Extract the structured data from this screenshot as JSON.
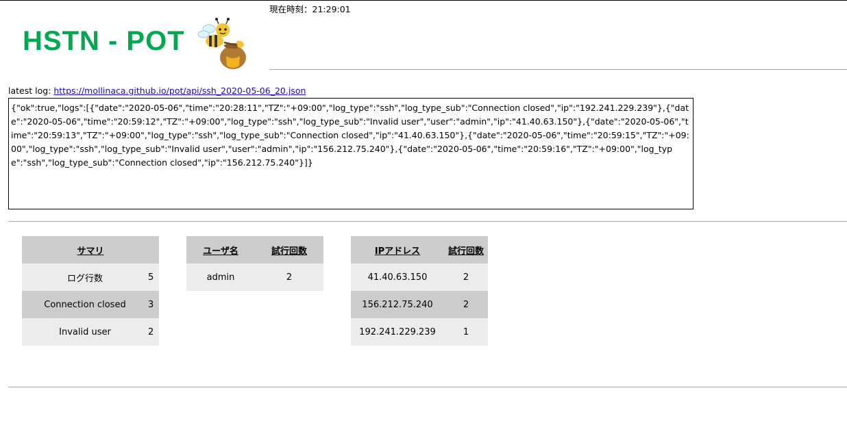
{
  "header": {
    "clock_label": "現在時刻：21:29:01",
    "logo_text": "HSTN - POT",
    "mascot_icon": "bee-honeypot-icon"
  },
  "latest_log": {
    "label": "latest log: ",
    "url": "https://mollinaca.github.io/pot/api/ssh_2020-05-06_20.json"
  },
  "json_text": "{\"ok\":true,\"logs\":[{\"date\":\"2020-05-06\",\"time\":\"20:28:11\",\"TZ\":\"+09:00\",\"log_type\":\"ssh\",\"log_type_sub\":\"Connection closed\",\"ip\":\"192.241.229.239\"},{\"date\":\"2020-05-06\",\"time\":\"20:59:12\",\"TZ\":\"+09:00\",\"log_type\":\"ssh\",\"log_type_sub\":\"Invalid user\",\"user\":\"admin\",\"ip\":\"41.40.63.150\"},{\"date\":\"2020-05-06\",\"time\":\"20:59:13\",\"TZ\":\"+09:00\",\"log_type\":\"ssh\",\"log_type_sub\":\"Connection closed\",\"ip\":\"41.40.63.150\"},{\"date\":\"2020-05-06\",\"time\":\"20:59:15\",\"TZ\":\"+09:00\",\"log_type\":\"ssh\",\"log_type_sub\":\"Invalid user\",\"user\":\"admin\",\"ip\":\"156.212.75.240\"},{\"date\":\"2020-05-06\",\"time\":\"20:59:16\",\"TZ\":\"+09:00\",\"log_type\":\"ssh\",\"log_type_sub\":\"Connection closed\",\"ip\":\"156.212.75.240\"}]}",
  "summary_table": {
    "header": "サマリ",
    "rows": [
      {
        "label": "ログ行数",
        "value": "5"
      },
      {
        "label": "Connection closed",
        "value": "3"
      },
      {
        "label": "Invalid user",
        "value": "2"
      }
    ]
  },
  "user_table": {
    "headers": [
      "ユーザ名",
      "試行回数"
    ],
    "rows": [
      {
        "user": "admin",
        "count": "2"
      }
    ]
  },
  "ip_table": {
    "headers": [
      "IPアドレス",
      "試行回数"
    ],
    "rows": [
      {
        "ip": "41.40.63.150",
        "count": "2"
      },
      {
        "ip": "156.212.75.240",
        "count": "2"
      },
      {
        "ip": "192.241.229.239",
        "count": "1"
      }
    ]
  },
  "colors": {
    "logo_green": "#00a84f",
    "table_dark": "#cccccc",
    "table_light": "#ececec",
    "link": "#1a0dab"
  }
}
